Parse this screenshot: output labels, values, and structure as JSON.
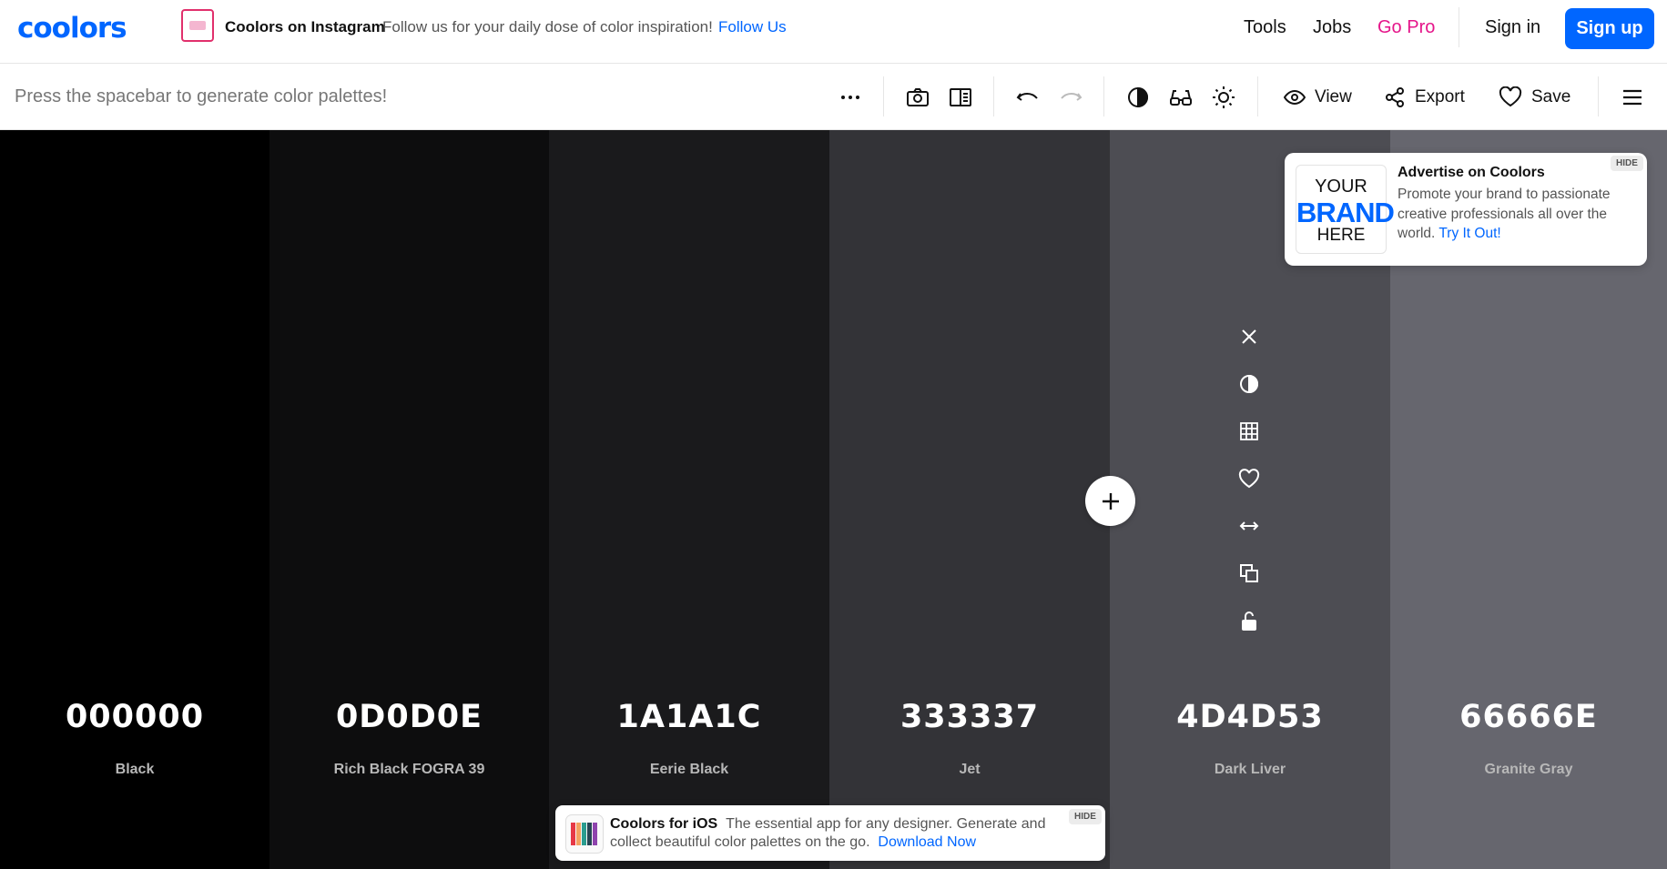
{
  "header": {
    "logo": "coolors",
    "promo_title": "Coolors on Instagram",
    "promo_text": "Follow us for your daily dose of color inspiration!",
    "promo_link": "Follow Us",
    "nav": [
      "Tools",
      "Jobs",
      "Go Pro",
      "Sign in"
    ],
    "signup": "Sign up",
    "accent": "#0066ff",
    "gopro_color": "#e5168a"
  },
  "toolbar": {
    "hint": "Press the spacebar to generate color palettes!",
    "view_label": "View",
    "export_label": "Export",
    "save_label": "Save",
    "icons": [
      "more-icon",
      "camera-icon",
      "layout-icon",
      "undo-icon",
      "redo-icon",
      "contrast-icon",
      "glasses-icon",
      "sun-icon",
      "menu-icon"
    ]
  },
  "palette": [
    {
      "hex": "000000",
      "name": "Black",
      "color": "#000000"
    },
    {
      "hex": "0D0D0E",
      "name": "Rich Black FOGRA 39",
      "color": "#0D0D0E"
    },
    {
      "hex": "1A1A1C",
      "name": "Eerie Black",
      "color": "#1A1A1C"
    },
    {
      "hex": "333337",
      "name": "Jet",
      "color": "#333337"
    },
    {
      "hex": "4D4D53",
      "name": "Dark Liver",
      "color": "#4D4D53"
    },
    {
      "hex": "66666E",
      "name": "Granite Gray",
      "color": "#66666E"
    }
  ],
  "swatch_tools": [
    "close-icon",
    "contrast-icon",
    "grid-icon",
    "heart-icon",
    "drag-icon",
    "copy-icon",
    "unlock-icon"
  ],
  "ad": {
    "logo_line1": "YOUR",
    "logo_line2": "BRAND",
    "logo_line3": "HERE",
    "title": "Advertise on Coolors",
    "body": "Promote your brand to passionate creative professionals all over the world.",
    "link": "Try It Out!",
    "hide": "HIDE"
  },
  "ios": {
    "title": "Coolors for iOS",
    "body": "The essential app for any designer. Generate and collect beautiful color palettes on the go.",
    "link": "Download Now",
    "hide": "HIDE"
  }
}
